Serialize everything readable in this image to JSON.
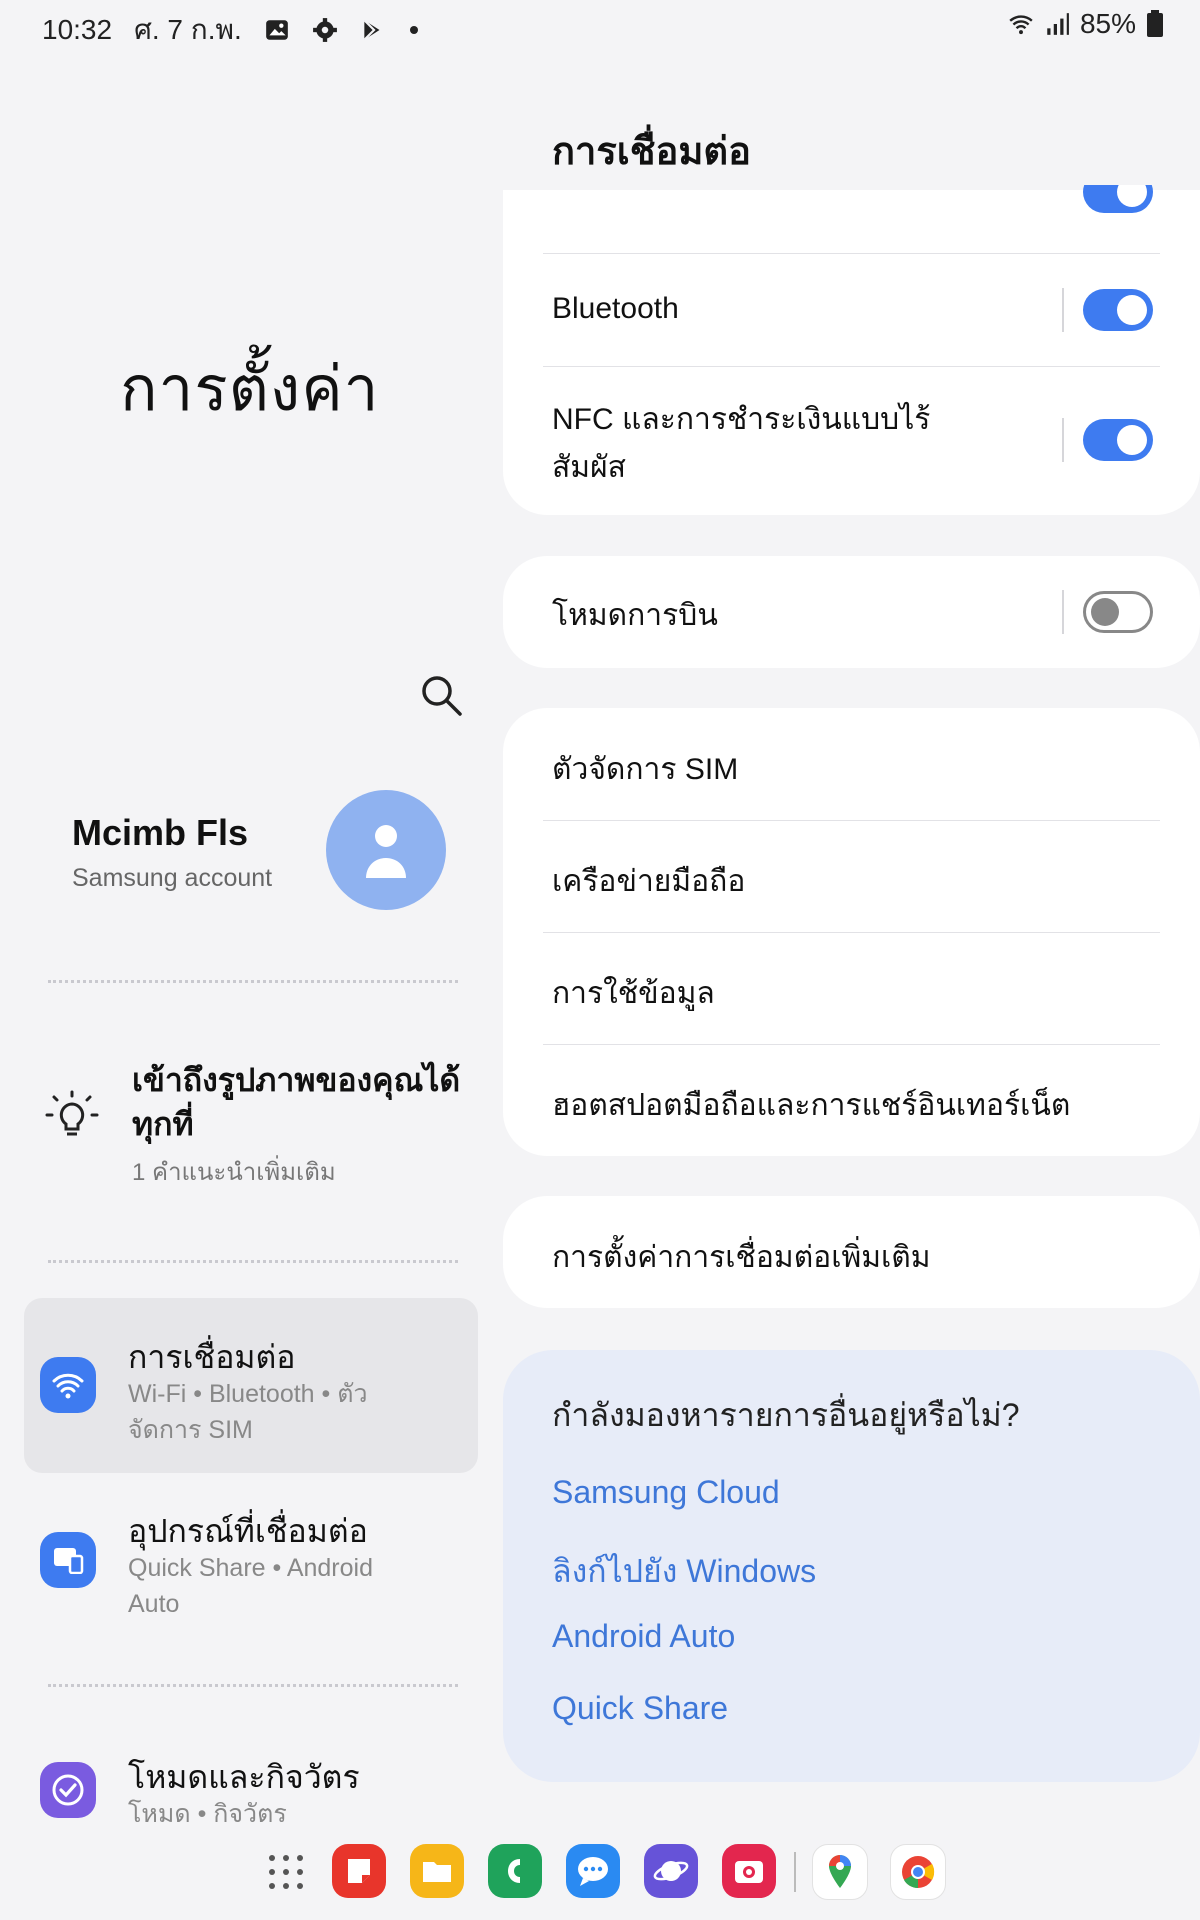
{
  "status_bar": {
    "time": "10:32",
    "date": "ศ. 7 ก.พ.",
    "battery": "85%",
    "icons": [
      "gallery-icon",
      "settings-gear-icon",
      "play-store-icon",
      "dot-icon",
      "wifi-icon",
      "signal-icon",
      "battery-icon"
    ]
  },
  "left": {
    "title": "การตั้งค่า",
    "profile": {
      "name": "Mcimb Fls",
      "sub": "Samsung account"
    },
    "tip": {
      "title": "เข้าถึงรูปภาพของคุณได้ทุกที่",
      "sub": "1 คำแนะนำเพิ่มเติม"
    },
    "categories": [
      {
        "title": "การเชื่อมต่อ",
        "sub": "Wi-Fi  •  Bluetooth  •  ตัวจัดการ SIM",
        "color": "#3e7bf0"
      },
      {
        "title": "อุปกรณ์ที่เชื่อมต่อ",
        "sub": "Quick Share  •  Android Auto",
        "color": "#3e7bf0"
      },
      {
        "title": "โหมดและกิจวัตร",
        "sub": "โหมด  •  กิจวัตร",
        "color": "#7a5be0"
      }
    ]
  },
  "right": {
    "title": "การเชื่อมต่อ",
    "rows": {
      "bluetooth": "Bluetooth",
      "nfc": "NFC และการชำระเงินแบบไร้สัมผัส",
      "airplane": "โหมดการบิน",
      "sim": "ตัวจัดการ SIM",
      "mobile_network": "เครือข่ายมือถือ",
      "data_usage": "การใช้ข้อมูล",
      "hotspot": "ฮอตสปอตมือถือและการแชร์อินเทอร์เน็ต",
      "more": "การตั้งค่าการเชื่อมต่อเพิ่มเติม"
    },
    "toggles": {
      "wifi": true,
      "bluetooth": true,
      "nfc": true,
      "airplane": false
    },
    "looking_for": {
      "title": "กำลังมองหารายการอื่นอยู่หรือไม่?",
      "links": [
        "Samsung Cloud",
        "ลิงก์ไปยัง Windows",
        "Android Auto",
        "Quick Share"
      ]
    }
  },
  "dock": {
    "apps": [
      "app-drawer-icon",
      "notes-icon",
      "my-files-icon",
      "phone-icon",
      "messages-icon",
      "internet-icon",
      "screen-recorder-icon",
      "maps-icon",
      "chrome-icon"
    ]
  },
  "colors": {
    "accent": "#3e7bf0",
    "link": "#3e77d8",
    "toggle_off": "#888888"
  }
}
